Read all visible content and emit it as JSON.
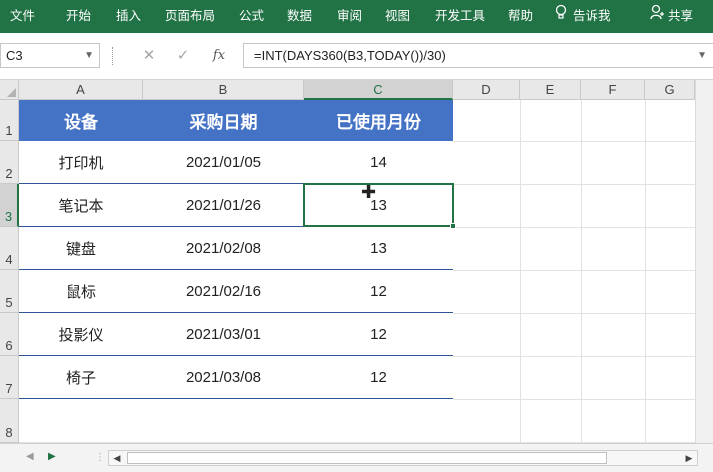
{
  "ribbon": {
    "tabs": [
      "文件",
      "开始",
      "插入",
      "页面布局",
      "公式",
      "数据",
      "审阅",
      "视图",
      "开发工具",
      "帮助"
    ],
    "tell_me": "告诉我",
    "share": "共享"
  },
  "formula_bar": {
    "name_box": "C3",
    "cancel_symbol": "✕",
    "enter_symbol": "✓",
    "fx_label": "fx",
    "formula": "=INT(DAYS360(B3,TODAY())/30)"
  },
  "columns": [
    "A",
    "B",
    "C",
    "D",
    "E",
    "F",
    "G"
  ],
  "rows": [
    "1",
    "2",
    "3",
    "4",
    "5",
    "6",
    "7",
    "8"
  ],
  "table": {
    "headers": [
      "设备",
      "采购日期",
      "已使用月份"
    ],
    "rows": [
      [
        "打印机",
        "2021/01/05",
        "14"
      ],
      [
        "笔记本",
        "2021/01/26",
        "13"
      ],
      [
        "键盘",
        "2021/02/08",
        "13"
      ],
      [
        "鼠标",
        "2021/02/16",
        "12"
      ],
      [
        "投影仪",
        "2021/03/01",
        "12"
      ],
      [
        "椅子",
        "2021/03/08",
        "12"
      ]
    ]
  },
  "selection": {
    "cell": "C3"
  },
  "colors": {
    "ribbon": "#217346",
    "header_fill": "#4472c4",
    "row_border": "#2f5597",
    "selection": "#217346"
  }
}
